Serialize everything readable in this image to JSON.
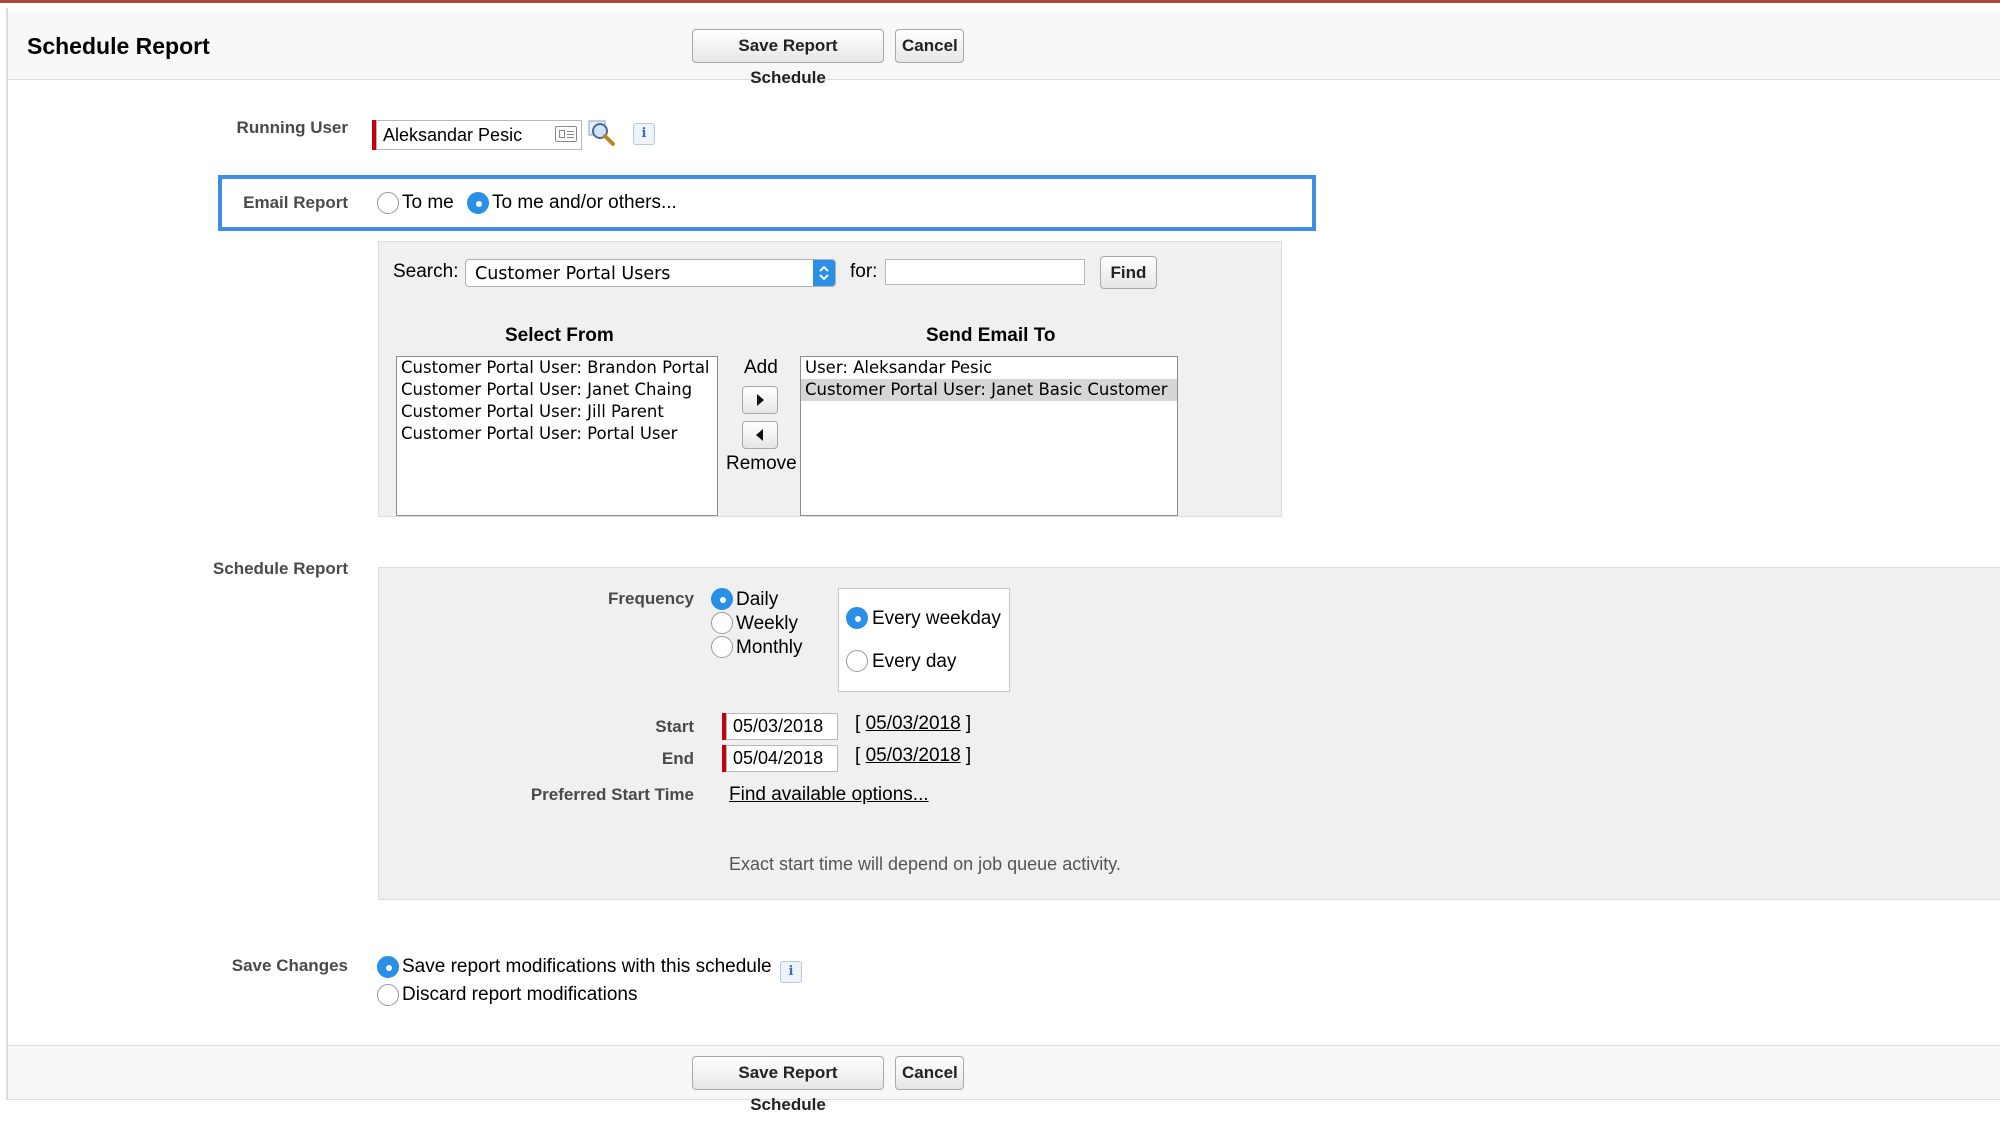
{
  "header": {
    "title": "Schedule Report",
    "save_label": "Save Report Schedule",
    "cancel_label": "Cancel"
  },
  "running_user": {
    "label": "Running User",
    "value": "Aleksandar Pesic"
  },
  "email_report": {
    "label": "Email Report",
    "options": [
      "To me",
      "To me and/or others..."
    ],
    "selected": "To me and/or others..."
  },
  "search": {
    "label": "Search:",
    "selected": "Customer Portal Users",
    "for_label": "for:",
    "for_value": "",
    "find_label": "Find"
  },
  "select_from": {
    "heading": "Select From",
    "items": [
      "Customer Portal User: Brandon Portal",
      "Customer Portal User: Janet Chaing",
      "Customer Portal User: Jill Parent",
      "Customer Portal User: Portal User"
    ]
  },
  "transfer": {
    "add_label": "Add",
    "remove_label": "Remove"
  },
  "send_email_to": {
    "heading": "Send Email To",
    "items": [
      "User: Aleksandar Pesic",
      "Customer Portal User: Janet Basic Customer"
    ],
    "selected_index": 1
  },
  "schedule": {
    "label": "Schedule Report",
    "frequency_label": "Frequency",
    "frequency_options": [
      "Daily",
      "Weekly",
      "Monthly"
    ],
    "frequency_selected": "Daily",
    "daily_options": [
      "Every weekday",
      "Every day"
    ],
    "daily_selected": "Every weekday",
    "start_label": "Start",
    "start_value": "05/03/2018",
    "start_today": "05/03/2018",
    "end_label": "End",
    "end_value": "05/04/2018",
    "end_today": "05/03/2018",
    "preferred_label": "Preferred Start Time",
    "preferred_link": "Find available options...",
    "note": "Exact start time will depend on job queue activity."
  },
  "save_changes": {
    "label": "Save Changes",
    "options": [
      "Save report modifications with this schedule",
      "Discard report modifications"
    ],
    "selected": "Save report modifications with this schedule"
  },
  "footer": {
    "save_label": "Save Report Schedule",
    "cancel_label": "Cancel"
  },
  "colors": {
    "accent_blue": "#2a8fe6",
    "highlight_border": "#3d8fe0",
    "required_red": "#c4000f",
    "top_bar": "#b0463a"
  }
}
